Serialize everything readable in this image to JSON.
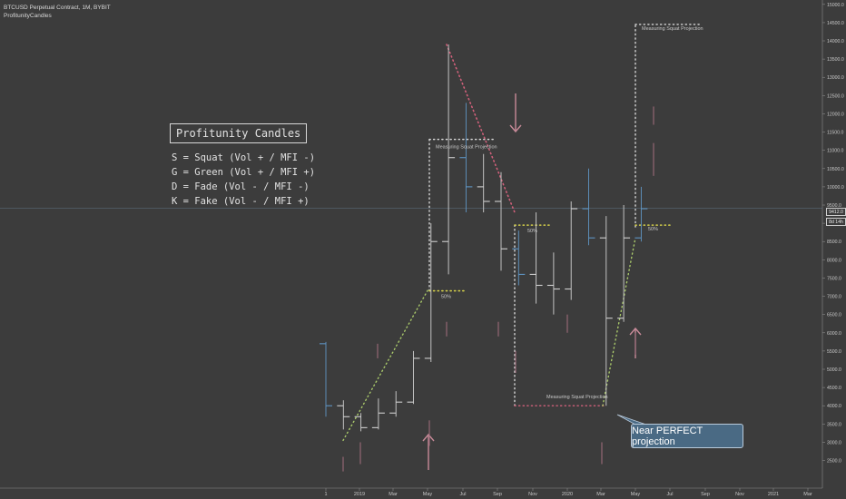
{
  "header": {
    "symbol_line": "BTCUSD Perpetual Contract, 1M, BYBIT",
    "indicator_line": "ProfitunityCandles"
  },
  "legend": {
    "title": "Profitunity Candles",
    "items": [
      "S = Squat (Vol + / MFI -)",
      "G = Green (Vol + / MFI +)",
      "D = Fade (Vol - / MFI -)",
      "K = Fake (Vol - / MFI +)"
    ]
  },
  "annotations": {
    "callout": "Near PERFECT projection",
    "projection_label": "Measuring Squat Projection",
    "fifty_label": "50%"
  },
  "price_tags": {
    "last_price": "9412.0",
    "countdown": "8d 14h"
  },
  "colors": {
    "background": "#3c3c3c",
    "up_candle": "#5f95c4",
    "neutral_candle": "#d0d0d0",
    "squat_candle": "#cfcfcf",
    "fake_candle": "#9a6a78",
    "pink_line": "#d0607a",
    "yellow_dots": "#d4cf4a",
    "green_dots": "#a9c96a",
    "white_dots": "#d8d8d8",
    "arrow": "#c78a98"
  },
  "icons": {
    "down_arrow": "arrow-down-icon",
    "up_arrow": "arrow-up-icon"
  },
  "chart_data": {
    "type": "candlestick",
    "y_ticks": [
      2500,
      3000,
      3500,
      4000,
      4500,
      5000,
      5500,
      6000,
      6500,
      7000,
      7500,
      8000,
      8500,
      9000,
      9500,
      10000,
      10500,
      11000,
      11500,
      12000,
      12500,
      13000,
      13500,
      14000,
      14500,
      15000
    ],
    "ylim": [
      2200,
      15300
    ],
    "x_ticks": [
      "1",
      "2019",
      "Mar",
      "May",
      "Jul",
      "Sep",
      "Nov",
      "2020",
      "Mar",
      "May",
      "Jul",
      "Sep",
      "Nov",
      "2021",
      "Mar"
    ],
    "last_price": 9412,
    "candles": [
      {
        "o": 5700,
        "h": 5750,
        "l": 3700,
        "c": 4000,
        "type": "up"
      },
      {
        "o": 4000,
        "h": 4150,
        "l": 3350,
        "c": 3700,
        "type": "neutral"
      },
      {
        "o": 3700,
        "h": 3800,
        "l": 3300,
        "c": 3400,
        "type": "neutral"
      },
      {
        "o": 3400,
        "h": 4200,
        "l": 3350,
        "c": 3800,
        "type": "neutral"
      },
      {
        "o": 3800,
        "h": 4400,
        "l": 3700,
        "c": 4100,
        "type": "neutral"
      },
      {
        "o": 4100,
        "h": 5500,
        "l": 4050,
        "c": 5300,
        "type": "neutral"
      },
      {
        "o": 5300,
        "h": 9000,
        "l": 5200,
        "c": 8500,
        "type": "squat"
      },
      {
        "o": 8500,
        "h": 13900,
        "l": 7600,
        "c": 10800,
        "type": "neutral"
      },
      {
        "o": 10800,
        "h": 12300,
        "l": 9300,
        "c": 10000,
        "type": "up"
      },
      {
        "o": 10000,
        "h": 10900,
        "l": 9300,
        "c": 9600,
        "type": "neutral"
      },
      {
        "o": 9600,
        "h": 10400,
        "l": 7700,
        "c": 8300,
        "type": "neutral"
      },
      {
        "o": 8300,
        "h": 8800,
        "l": 7300,
        "c": 7600,
        "type": "up"
      },
      {
        "o": 7600,
        "h": 9300,
        "l": 6800,
        "c": 7300,
        "type": "neutral"
      },
      {
        "o": 7300,
        "h": 8200,
        "l": 6500,
        "c": 7200,
        "type": "neutral"
      },
      {
        "o": 7200,
        "h": 9600,
        "l": 6900,
        "c": 9400,
        "type": "neutral"
      },
      {
        "o": 9400,
        "h": 10500,
        "l": 8400,
        "c": 8600,
        "type": "up"
      },
      {
        "o": 8600,
        "h": 9200,
        "l": 4000,
        "c": 6400,
        "type": "neutral"
      },
      {
        "o": 6400,
        "h": 9500,
        "l": 6300,
        "c": 8600,
        "type": "neutral"
      },
      {
        "o": 8600,
        "h": 10000,
        "l": 8500,
        "c": 9400,
        "type": "up"
      }
    ],
    "squat_projections": [
      {
        "label": "Measuring Squat Projection",
        "low": 7150,
        "high": 11300,
        "fifty": 7150
      },
      {
        "label": "Measuring Squat Projection",
        "low": 4000,
        "high": 8950,
        "fifty": 8950
      },
      {
        "label": "Measuring Squat Projection",
        "low": 8900,
        "high": 14450,
        "fifty": 8900
      }
    ]
  }
}
